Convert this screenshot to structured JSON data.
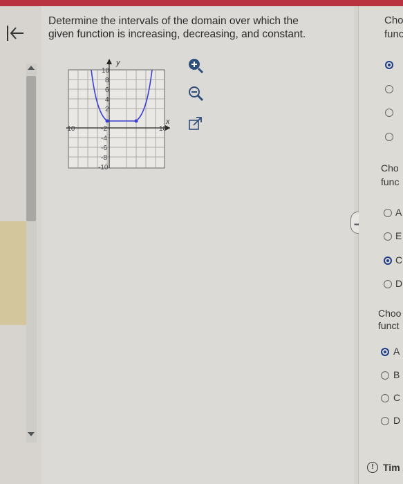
{
  "question": {
    "line1": "Determine the intervals of the domain over which the",
    "line2": "given function is increasing, decreasing, and constant."
  },
  "graph": {
    "y_axis_label": "y",
    "x_axis_label": "x",
    "x_ticks": [
      "-10",
      "10"
    ],
    "y_ticks": [
      "10",
      "8",
      "6",
      "4",
      "2",
      "-2",
      "-4",
      "-6",
      "-8",
      "-10"
    ],
    "curve_color": "#3b3fd0"
  },
  "tools": {
    "zoom_in": "zoom-in-icon",
    "zoom_out": "zoom-out-icon",
    "popout": "external-link-icon"
  },
  "right_panel": {
    "section1": {
      "prompt_line1": "Cho",
      "prompt_line2": "func",
      "options": [
        {
          "letter": "",
          "selected": true
        },
        {
          "letter": "",
          "selected": false
        },
        {
          "letter": "",
          "selected": false
        },
        {
          "letter": "",
          "selected": false
        }
      ]
    },
    "section2": {
      "prompt_line1": "Cho",
      "prompt_line2": "func",
      "options": [
        {
          "letter": "A",
          "selected": false
        },
        {
          "letter": "E",
          "selected": false
        },
        {
          "letter": "C",
          "selected": true
        },
        {
          "letter": "D",
          "selected": false
        }
      ]
    },
    "section3": {
      "prompt_line1": "Choo",
      "prompt_line2": "funct",
      "options": [
        {
          "letter": "A",
          "selected": true
        },
        {
          "letter": "B",
          "selected": false
        },
        {
          "letter": "C",
          "selected": false
        },
        {
          "letter": "D",
          "selected": false
        }
      ]
    },
    "timer_label": "Tim"
  },
  "splitter_label": "•••••"
}
